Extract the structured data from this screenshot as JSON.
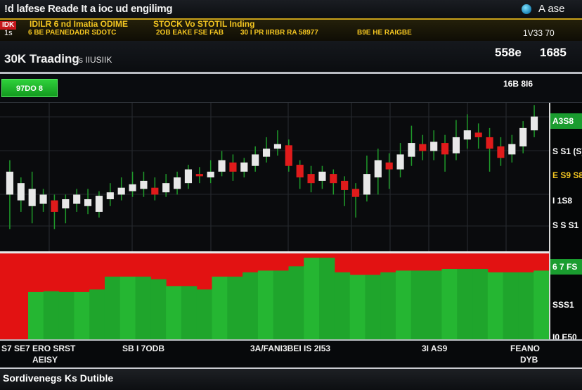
{
  "title_bar": {
    "title": "!d lafese Reade It a ioc ud engilimg",
    "right_text": "A ase"
  },
  "ticker": {
    "tag1": "IDK",
    "item1": "IDILR 6 nd Imatia ODIME",
    "item2": "STOCK Vo STOTIL Inding",
    "row2_item1": "6 BE PAENEDADR SDOTC",
    "row2_item2": "2OB EAKE FSE FAB",
    "row2_item3": "30 I PR IIRBR RA 58977",
    "row2_item4": "B9E HE RAIGBE",
    "row2_right": "1V33 70",
    "row2_tag": "1s"
  },
  "info": {
    "title": "30K Traading",
    "subtitle": "s IIUSIIK",
    "price_label": "558e",
    "price_value": "1685"
  },
  "toolbar": {
    "button_label": "97DO 8",
    "right_text": "16B 8I6"
  },
  "scale": {
    "labels": [
      "A3S8",
      "S S1 (S)",
      "E S9 S8",
      "I 1S8",
      "S S S1",
      "6 7 FS",
      "SSS1",
      "I0 E50"
    ],
    "colors": [
      "#1a9c2f",
      "#ffffff",
      "#f3c521",
      "#ffffff",
      "#ffffff",
      "#1a9c2f",
      "#ffffff",
      "#ffffff"
    ]
  },
  "x_axis": {
    "label1": "S7 SE7 ERO SRST",
    "label1b": "AEISY",
    "label2": "SB I 7ODB",
    "label3": "3A/FANI3BEI IS 2I53",
    "label4": "3I AS9",
    "label5": "FEANO",
    "label5b": "DYB"
  },
  "status": {
    "text": "Sordivenegs Ks Dutible"
  },
  "chart_data": {
    "type": "candlestick",
    "candles": [
      {
        "o": 300,
        "c": 320,
        "h": 330,
        "l": 270
      },
      {
        "o": 295,
        "c": 310,
        "h": 315,
        "l": 285
      },
      {
        "o": 290,
        "c": 305,
        "h": 320,
        "l": 275
      },
      {
        "o": 292,
        "c": 300,
        "h": 305,
        "l": 285
      },
      {
        "o": 295,
        "c": 285,
        "h": 300,
        "l": 270
      },
      {
        "o": 288,
        "c": 296,
        "h": 300,
        "l": 275
      },
      {
        "o": 292,
        "c": 300,
        "h": 305,
        "l": 285
      },
      {
        "o": 290,
        "c": 296,
        "h": 305,
        "l": 283
      },
      {
        "o": 285,
        "c": 299,
        "h": 303,
        "l": 280
      },
      {
        "o": 296,
        "c": 302,
        "h": 310,
        "l": 290
      },
      {
        "o": 300,
        "c": 306,
        "h": 315,
        "l": 295
      },
      {
        "o": 303,
        "c": 309,
        "h": 320,
        "l": 298
      },
      {
        "o": 305,
        "c": 312,
        "h": 320,
        "l": 298
      },
      {
        "o": 306,
        "c": 300,
        "h": 315,
        "l": 295
      },
      {
        "o": 302,
        "c": 310,
        "h": 318,
        "l": 298
      },
      {
        "o": 305,
        "c": 315,
        "h": 320,
        "l": 300
      },
      {
        "o": 310,
        "c": 322,
        "h": 326,
        "l": 305
      },
      {
        "o": 318,
        "c": 316,
        "h": 324,
        "l": 310
      },
      {
        "o": 315,
        "c": 320,
        "h": 330,
        "l": 310
      },
      {
        "o": 320,
        "c": 330,
        "h": 338,
        "l": 316
      },
      {
        "o": 328,
        "c": 320,
        "h": 335,
        "l": 312
      },
      {
        "o": 320,
        "c": 328,
        "h": 332,
        "l": 315
      },
      {
        "o": 325,
        "c": 335,
        "h": 342,
        "l": 320
      },
      {
        "o": 333,
        "c": 340,
        "h": 350,
        "l": 328
      },
      {
        "o": 340,
        "c": 344,
        "h": 356,
        "l": 334
      },
      {
        "o": 343,
        "c": 325,
        "h": 348,
        "l": 320
      },
      {
        "o": 326,
        "c": 315,
        "h": 330,
        "l": 305
      },
      {
        "o": 318,
        "c": 310,
        "h": 325,
        "l": 302
      },
      {
        "o": 312,
        "c": 320,
        "h": 325,
        "l": 305
      },
      {
        "o": 318,
        "c": 310,
        "h": 322,
        "l": 300
      },
      {
        "o": 312,
        "c": 304,
        "h": 316,
        "l": 290
      },
      {
        "o": 305,
        "c": 298,
        "h": 310,
        "l": 280
      },
      {
        "o": 300,
        "c": 318,
        "h": 334,
        "l": 294
      },
      {
        "o": 315,
        "c": 330,
        "h": 340,
        "l": 300
      },
      {
        "o": 328,
        "c": 322,
        "h": 336,
        "l": 305
      },
      {
        "o": 322,
        "c": 335,
        "h": 345,
        "l": 315
      },
      {
        "o": 333,
        "c": 345,
        "h": 360,
        "l": 325
      },
      {
        "o": 344,
        "c": 338,
        "h": 352,
        "l": 330
      },
      {
        "o": 338,
        "c": 346,
        "h": 356,
        "l": 330
      },
      {
        "o": 345,
        "c": 335,
        "h": 352,
        "l": 320
      },
      {
        "o": 336,
        "c": 350,
        "h": 365,
        "l": 330
      },
      {
        "o": 348,
        "c": 356,
        "h": 370,
        "l": 340
      },
      {
        "o": 354,
        "c": 350,
        "h": 362,
        "l": 340
      },
      {
        "o": 350,
        "c": 340,
        "h": 358,
        "l": 320
      },
      {
        "o": 342,
        "c": 332,
        "h": 350,
        "l": 325
      },
      {
        "o": 335,
        "c": 344,
        "h": 352,
        "l": 328
      },
      {
        "o": 342,
        "c": 358,
        "h": 364,
        "l": 336
      },
      {
        "o": 356,
        "c": 368,
        "h": 378,
        "l": 350
      }
    ],
    "volume": [
      0.55,
      0.56,
      0.55,
      0.55,
      0.58,
      0.73,
      0.73,
      0.73,
      0.7,
      0.62,
      0.62,
      0.58,
      0.73,
      0.73,
      0.78,
      0.8,
      0.8,
      0.85,
      0.95,
      0.95,
      0.78,
      0.75,
      0.75,
      0.78,
      0.8,
      0.8,
      0.8,
      0.82,
      0.82,
      0.82,
      0.78,
      0.78,
      0.78,
      0.8
    ],
    "ylim": [
      250,
      380
    ]
  },
  "colors": {
    "up": "#e8e8e8",
    "down": "#e01b1b",
    "volume": "#1fa52c",
    "volume_bg": "#e21212"
  }
}
